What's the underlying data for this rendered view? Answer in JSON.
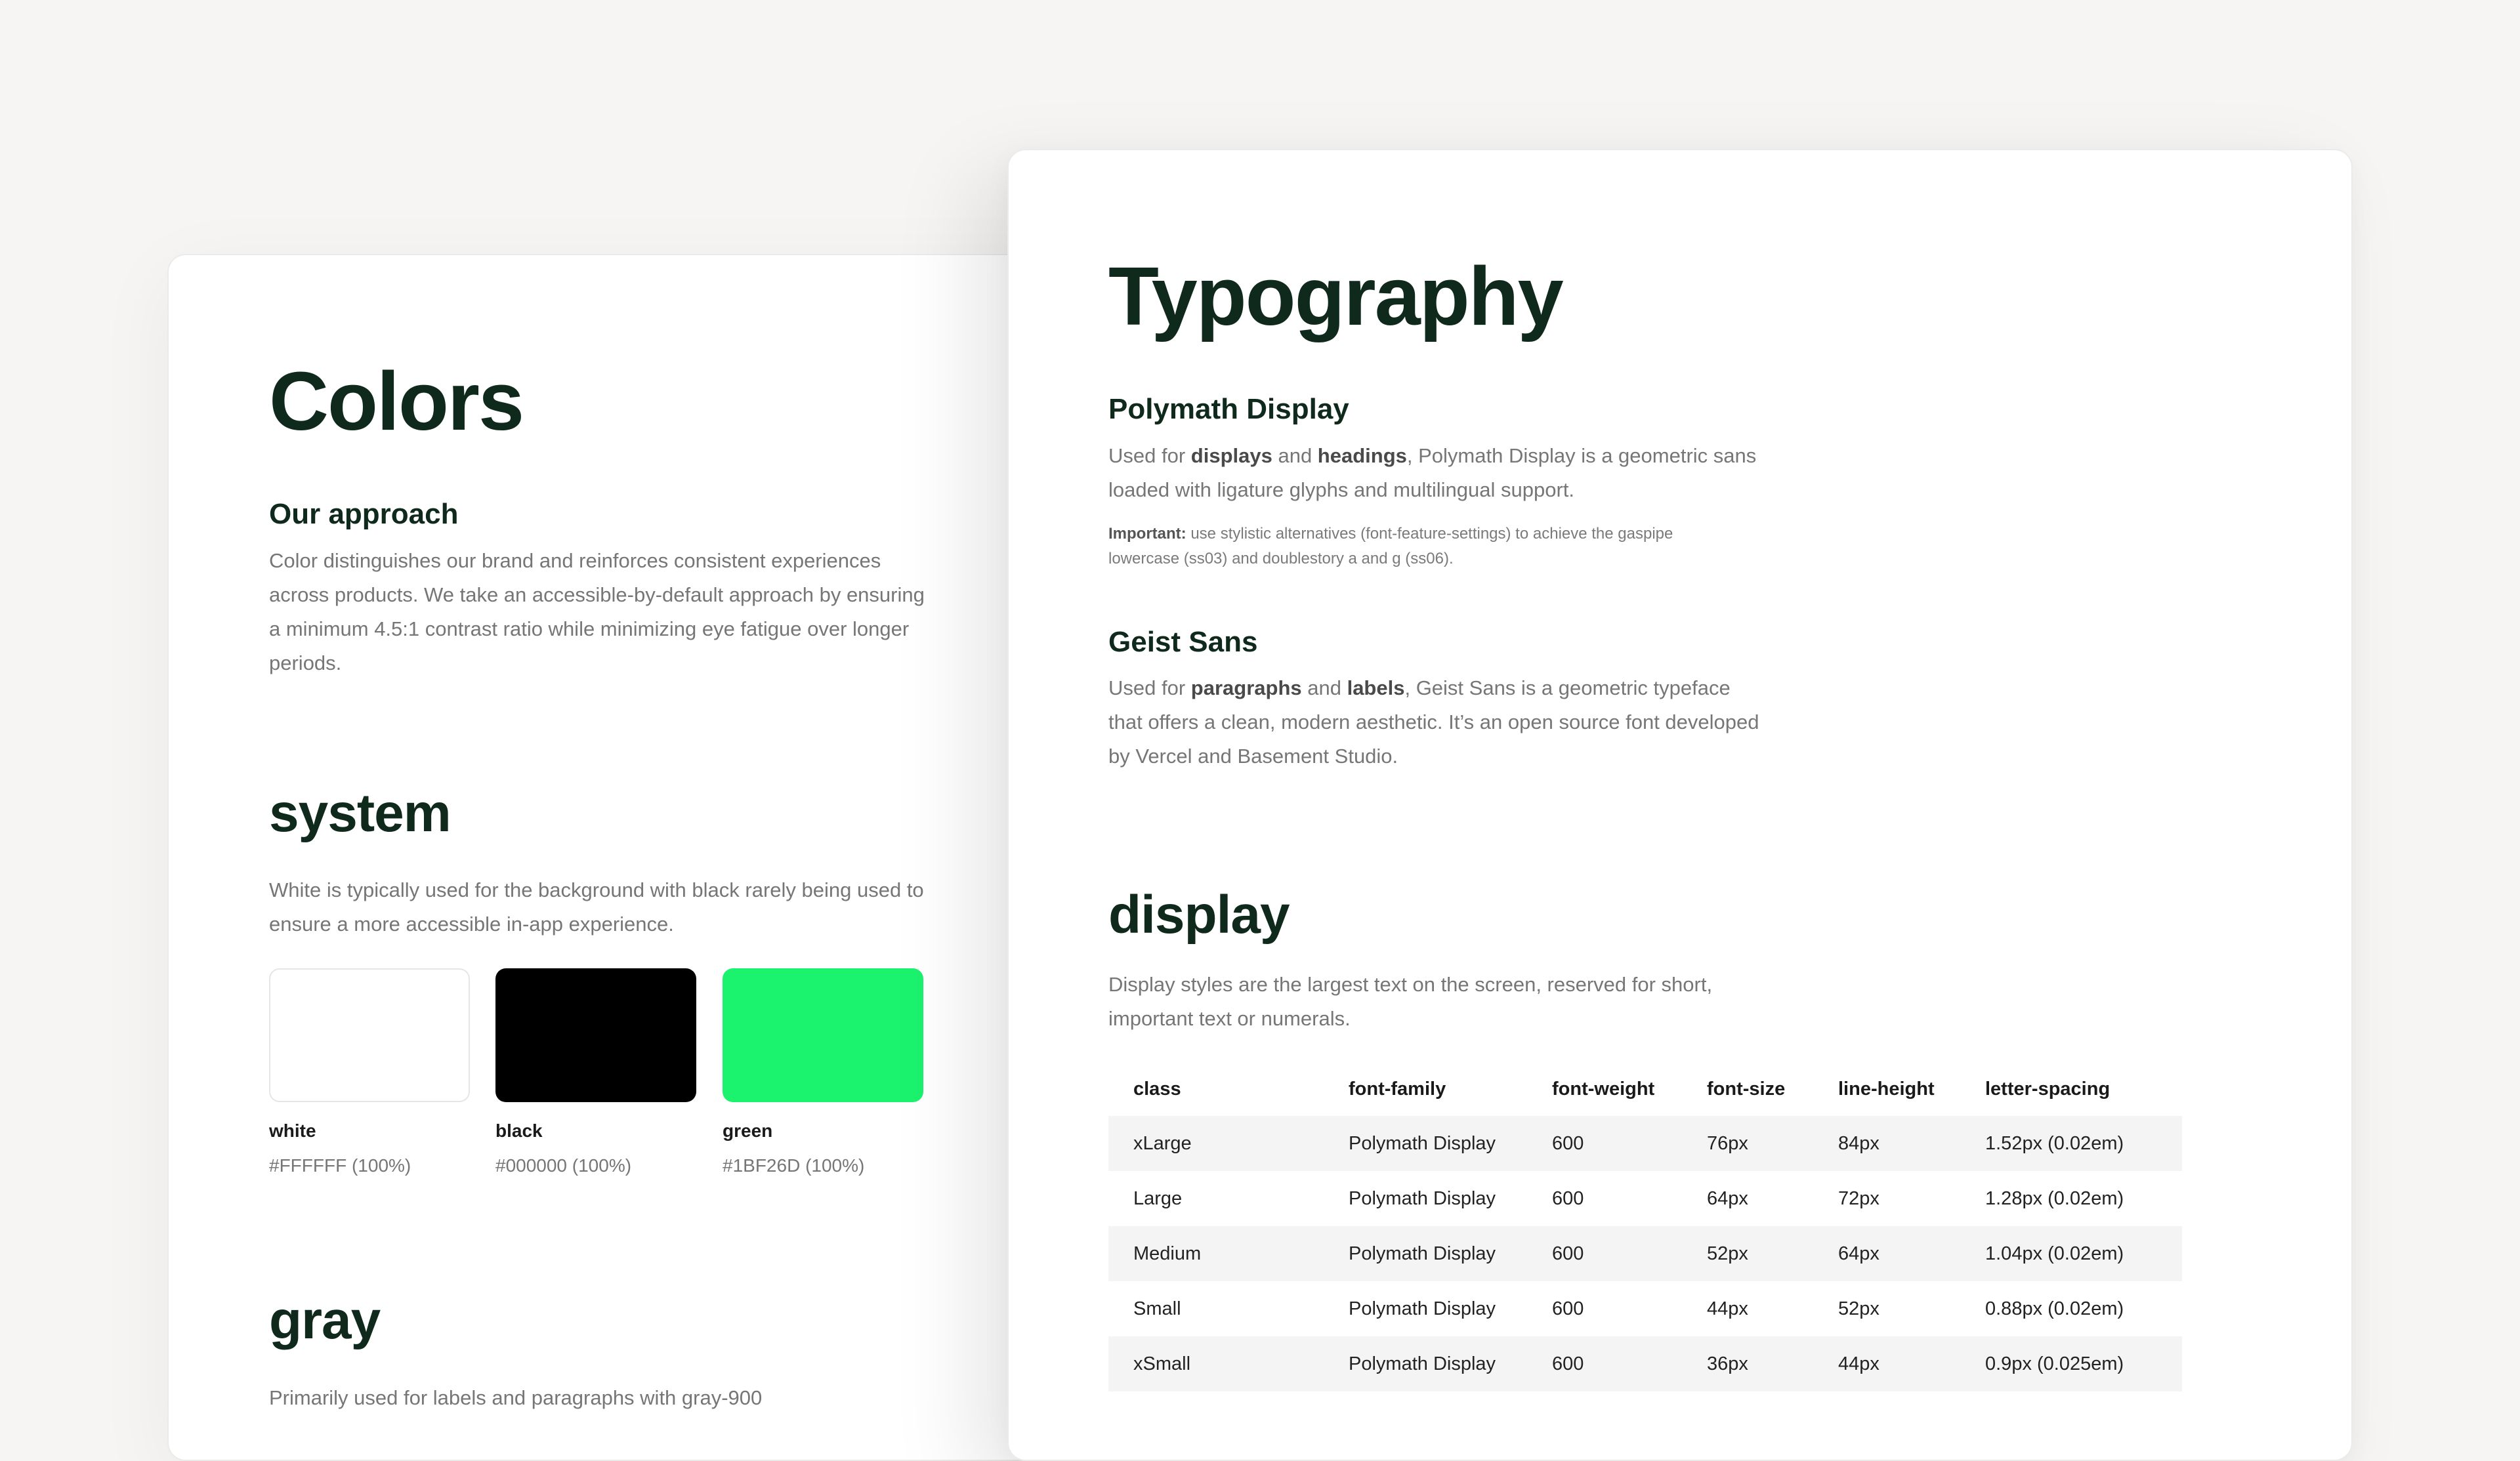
{
  "colors_card": {
    "title": "Colors",
    "approach": {
      "heading": "Our approach",
      "text": "Color distinguishes our brand and reinforces consistent experiences across products. We take an accessible-by-default approach by ensuring a minimum 4.5:1 contrast ratio while minimizing eye fatigue over longer periods."
    },
    "system": {
      "heading": "system",
      "text": "White is typically used for the background with black rarely being used to ensure a more accessible in-app experience.",
      "swatches": [
        {
          "name": "white",
          "hex": "#FFFFFF (100%)",
          "color": "#FFFFFF"
        },
        {
          "name": "black",
          "hex": "#000000 (100%)",
          "color": "#000000"
        },
        {
          "name": "green",
          "hex": "#1BF26D (100%)",
          "color": "#1BF26D"
        }
      ]
    },
    "gray": {
      "heading": "gray",
      "text": "Primarily used for labels and paragraphs with gray-900"
    }
  },
  "typography_card": {
    "title": "Typography",
    "polymath": {
      "heading": "Polymath Display",
      "text_pre": "Used for ",
      "text_b1": "displays",
      "text_mid": " and ",
      "text_b2": "headings",
      "text_post": ", Polymath Display is a geometric sans loaded with ligature glyphs and multilingual support.",
      "note_label": "Important:",
      "note_text": " use stylistic alternatives (font-feature-settings) to achieve the gaspipe lowercase (ss03) and doublestory a and g (ss06)."
    },
    "geist": {
      "heading": "Geist Sans",
      "text_pre": "Used for ",
      "text_b1": "paragraphs",
      "text_mid": " and ",
      "text_b2": "labels",
      "text_post": ", Geist Sans is a geometric typeface that offers a clean, modern aesthetic. It’s an open source font developed by Vercel and Basement Studio."
    },
    "display": {
      "heading": "display",
      "text": "Display styles are the largest text on the screen, reserved for short, important text or numerals.",
      "columns": [
        "class",
        "font-family",
        "font-weight",
        "font-size",
        "line-height",
        "letter-spacing"
      ],
      "rows": [
        [
          "xLarge",
          "Polymath Display",
          "600",
          "76px",
          "84px",
          "1.52px (0.02em)"
        ],
        [
          "Large",
          "Polymath Display",
          "600",
          "64px",
          "72px",
          "1.28px (0.02em)"
        ],
        [
          "Medium",
          "Polymath Display",
          "600",
          "52px",
          "64px",
          "1.04px (0.02em)"
        ],
        [
          "Small",
          "Polymath Display",
          "600",
          "44px",
          "52px",
          "0.88px (0.02em)"
        ],
        [
          "xSmall",
          "Polymath Display",
          "600",
          "36px",
          "44px",
          "0.9px (0.025em)"
        ]
      ]
    }
  }
}
